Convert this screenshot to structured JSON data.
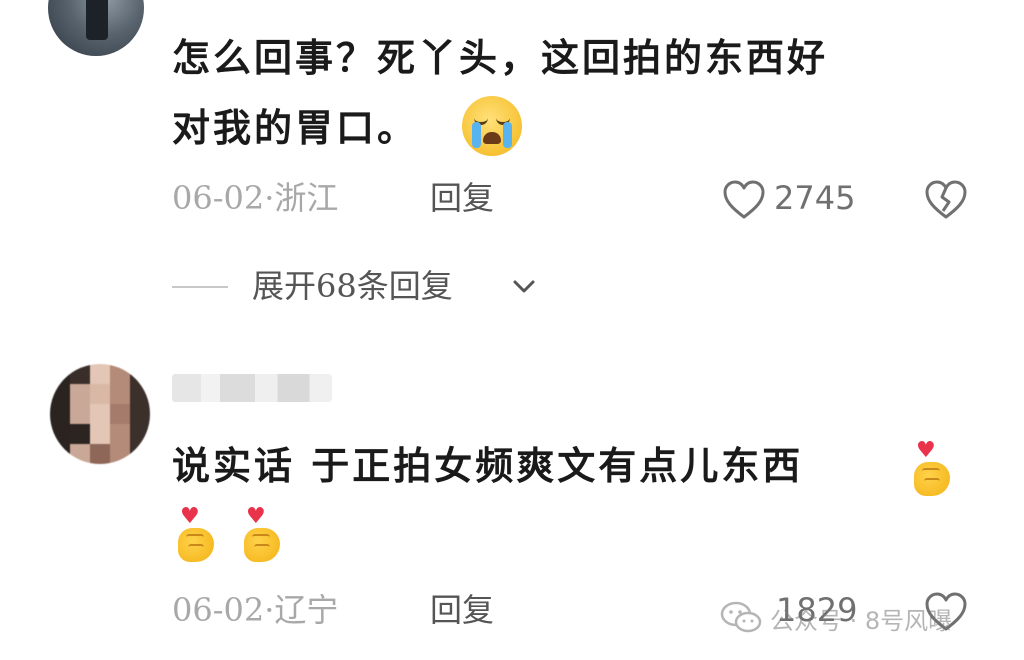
{
  "comments": [
    {
      "text_line1": "怎么回事？死丫头，这回拍的东西好",
      "text_line2": "对我的胃口。",
      "emoji": "loudly-crying-face",
      "date_location": "06-02·浙江",
      "reply_label": "回复",
      "like_count": "2745",
      "expand_label": "展开68条回复"
    },
    {
      "text_line1": "说实话 于正拍女频爽文有点儿东西",
      "emoji": "finger-heart",
      "date_location": "06-02·辽宁",
      "reply_label": "回复",
      "like_count": "1829"
    }
  ],
  "watermark": {
    "text": "公众号 · 8号风曝"
  },
  "colors": {
    "primary_text": "#1a1a1a",
    "meta_text": "#a8a8a8",
    "action_text": "#555555",
    "like_icon": "#707070"
  }
}
